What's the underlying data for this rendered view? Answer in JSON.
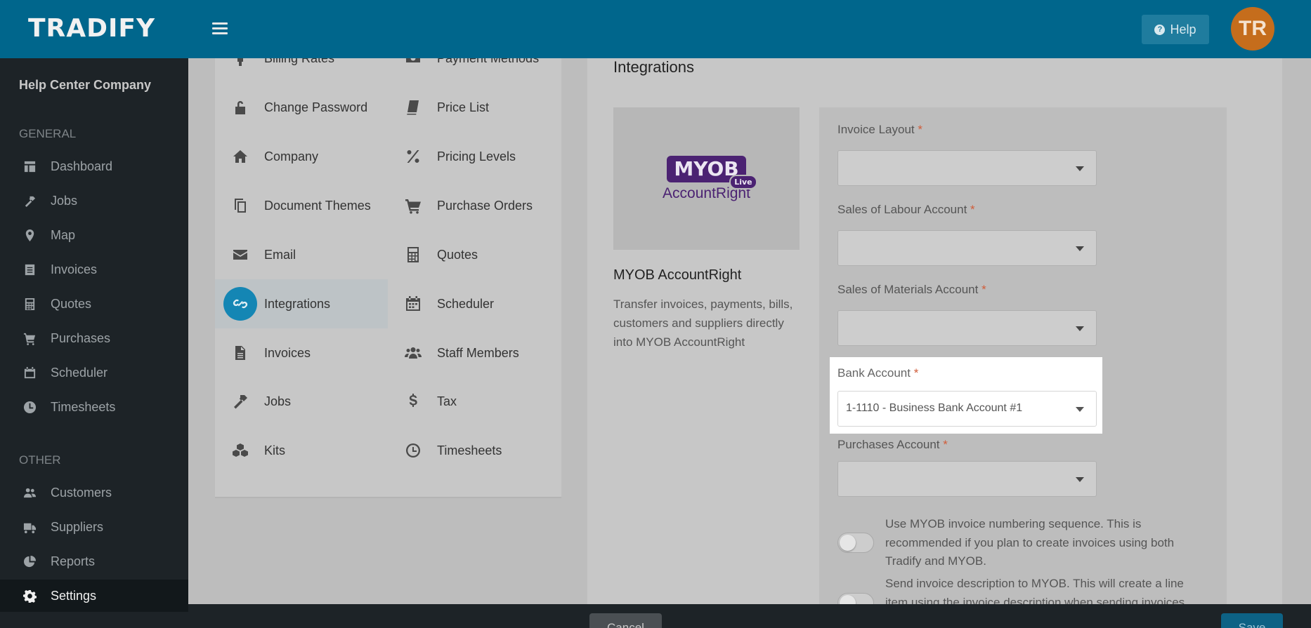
{
  "topbar": {
    "logo": "TRADIFY",
    "help_label": "Help",
    "avatar_initials": "TR"
  },
  "sidebar": {
    "company": "Help Center Company",
    "general_title": "GENERAL",
    "general_items": [
      {
        "label": "Dashboard",
        "icon": "dashboard-icon"
      },
      {
        "label": "Jobs",
        "icon": "hammer-icon"
      },
      {
        "label": "Map",
        "icon": "map-pin-icon"
      },
      {
        "label": "Invoices",
        "icon": "document-icon"
      },
      {
        "label": "Quotes",
        "icon": "calculator-icon"
      },
      {
        "label": "Purchases",
        "icon": "cart-icon"
      },
      {
        "label": "Scheduler",
        "icon": "calendar-icon"
      },
      {
        "label": "Timesheets",
        "icon": "clock-icon"
      }
    ],
    "other_title": "OTHER",
    "other_items": [
      {
        "label": "Customers",
        "icon": "users-icon"
      },
      {
        "label": "Suppliers",
        "icon": "truck-icon"
      },
      {
        "label": "Reports",
        "icon": "pie-chart-icon"
      },
      {
        "label": "Settings",
        "icon": "gear-icon",
        "active": true
      }
    ]
  },
  "settings_menu": {
    "left": [
      {
        "label": "Billing Rates",
        "icon": "person-icon"
      },
      {
        "label": "Change Password",
        "icon": "unlock-icon"
      },
      {
        "label": "Company",
        "icon": "home-icon"
      },
      {
        "label": "Document Themes",
        "icon": "copy-icon"
      },
      {
        "label": "Email",
        "icon": "envelope-icon"
      },
      {
        "label": "Integrations",
        "icon": "link-icon",
        "active": true
      },
      {
        "label": "Invoices",
        "icon": "file-icon"
      },
      {
        "label": "Jobs",
        "icon": "hammer-icon"
      },
      {
        "label": "Kits",
        "icon": "cubes-icon"
      }
    ],
    "right": [
      {
        "label": "Payment Methods",
        "icon": "money-icon"
      },
      {
        "label": "Price List",
        "icon": "book-icon"
      },
      {
        "label": "Pricing Levels",
        "icon": "percent-icon"
      },
      {
        "label": "Purchase Orders",
        "icon": "cart-icon"
      },
      {
        "label": "Quotes",
        "icon": "calculator-icon"
      },
      {
        "label": "Scheduler",
        "icon": "calendar-icon"
      },
      {
        "label": "Staff Members",
        "icon": "users-icon"
      },
      {
        "label": "Tax",
        "icon": "dollar-icon"
      },
      {
        "label": "Timesheets",
        "icon": "clock-icon"
      }
    ]
  },
  "integration": {
    "section_title": "Integrations",
    "logo_text": "MYOB",
    "logo_badge": "Live",
    "logo_sub": "AccountRight",
    "name": "MYOB AccountRight",
    "description": "Transfer invoices, payments, bills, customers and suppliers directly into MYOB AccountRight"
  },
  "form": {
    "required_mark": "*",
    "invoice_layout": {
      "label": "Invoice Layout",
      "value": ""
    },
    "sales_labour": {
      "label": "Sales of Labour Account",
      "value": ""
    },
    "sales_materials": {
      "label": "Sales of Materials Account",
      "value": ""
    },
    "bank_account": {
      "label": "Bank Account",
      "value": "1-1110 - Business Bank Account #1"
    },
    "purchases": {
      "label": "Purchases Account",
      "value": ""
    },
    "toggle_numbering": {
      "text": "Use MYOB invoice numbering sequence. This is recommended if you plan to create invoices using both Tradify and MYOB.",
      "on": false
    },
    "toggle_description": {
      "text": "Send invoice description to MYOB. This will create a line item using the invoice description when sending invoices",
      "on": false
    }
  },
  "footer": {
    "cancel_label": "Cancel",
    "save_label": "Save"
  }
}
